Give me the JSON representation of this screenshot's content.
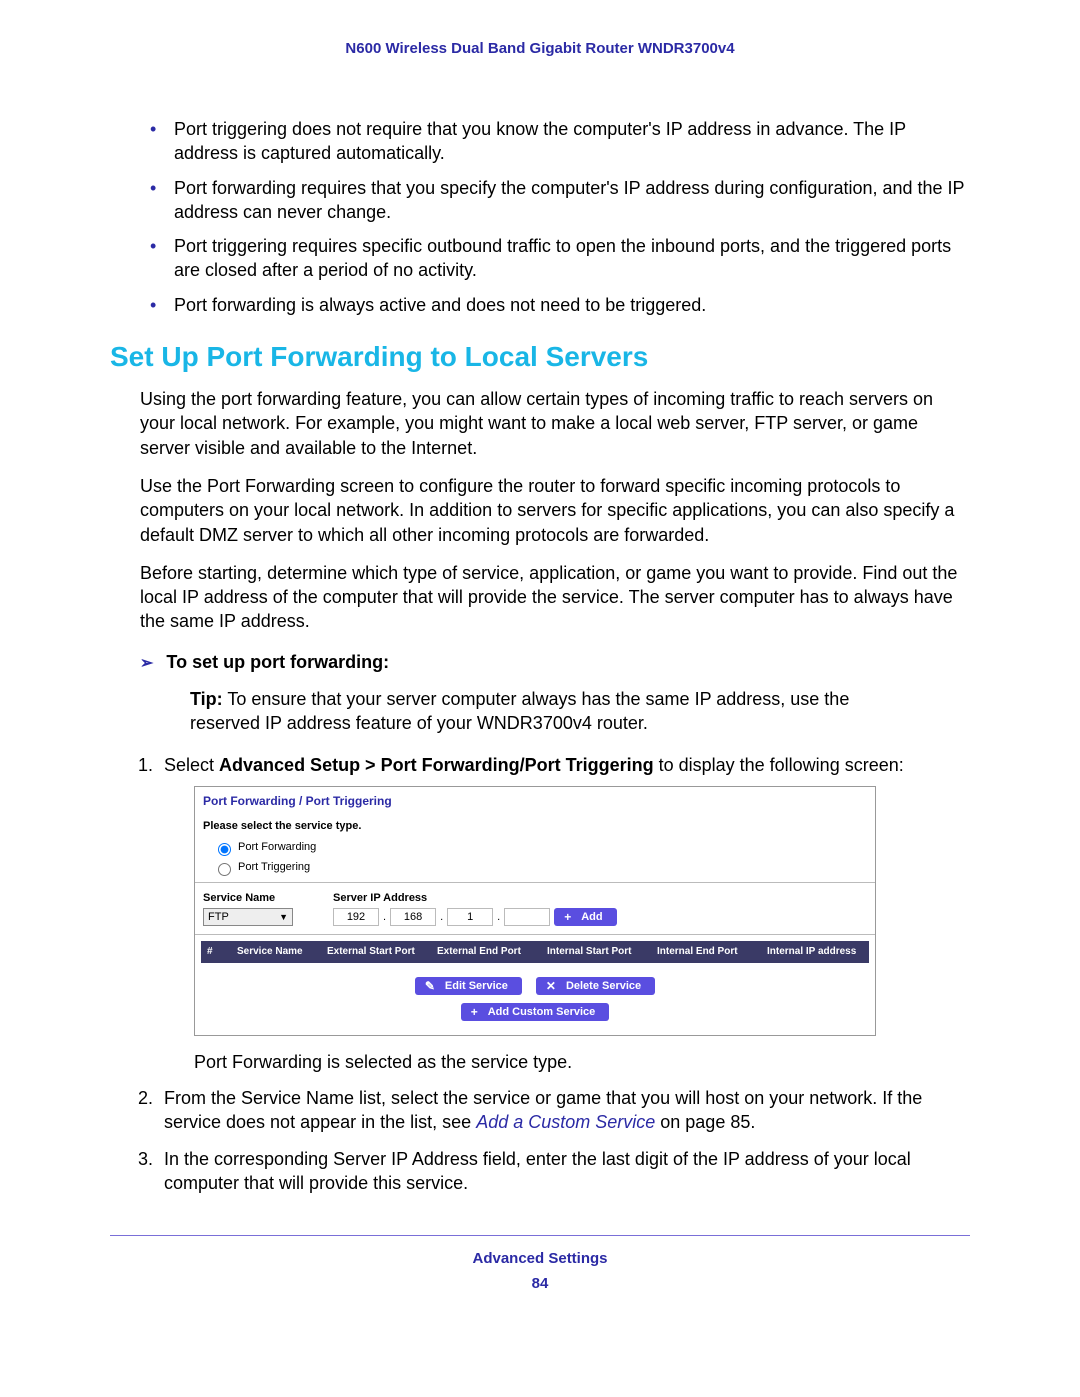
{
  "header": {
    "title": "N600 Wireless Dual Band Gigabit Router WNDR3700v4"
  },
  "bullets": [
    "Port triggering does not require that you know the computer's IP address in advance. The IP address is captured automatically.",
    "Port forwarding requires that you specify the computer's IP address during configuration, and the IP address can never change.",
    "Port triggering requires specific outbound traffic to open the inbound ports, and the triggered ports are closed after a period of no activity.",
    "Port forwarding is always active and does not need to be triggered."
  ],
  "section": {
    "heading": "Set Up Port Forwarding to Local Servers"
  },
  "paras": {
    "p1": "Using the port forwarding feature, you can allow certain types of incoming traffic to reach servers on your local network. For example, you might want to make a local web server, FTP server, or game server visible and available to the Internet.",
    "p2": "Use the Port Forwarding screen to configure the router to forward specific incoming protocols to computers on your local network. In addition to servers for specific applications, you can also specify a default DMZ server to which all other incoming protocols are forwarded.",
    "p3": "Before starting, determine which type of service, application, or game you want to provide. Find out the local IP address of the computer that will provide the service. The server computer has to always have the same IP address."
  },
  "proc": {
    "heading": "To set up port forwarding:",
    "tip_label": "Tip:",
    "tip": " To ensure that your server computer always has the same IP address, use the reserved IP address feature of your WNDR3700v4 router.",
    "step1_prefix": "Select ",
    "step1_bold": "Advanced Setup > Port Forwarding/Port Triggering",
    "step1_suffix": " to display the following screen:",
    "after_shot": "Port Forwarding is selected as the service type.",
    "step2_a": "From the Service Name list, select the service or game that you will host on your network. If the service does not appear in the list, see ",
    "step2_link": "Add a Custom Service",
    "step2_b": " on page 85.",
    "step3": "In the corresponding Server IP Address field, enter the last digit of the IP address of your local computer that will provide this service."
  },
  "ui": {
    "title": "Port Forwarding / Port Triggering",
    "select_label": "Please select the service type.",
    "radio1": "Port Forwarding",
    "radio2": "Port Triggering",
    "service_name_label": "Service Name",
    "server_ip_label": "Server IP Address",
    "service_value": "FTP",
    "ip": {
      "o1": "192",
      "o2": "168",
      "o3": "1",
      "o4": ""
    },
    "add_btn": "Add",
    "columns": {
      "c0": "#",
      "c1": "Service Name",
      "c2": "External Start Port",
      "c3": "External End Port",
      "c4": "Internal Start Port",
      "c5": "Internal End Port",
      "c6": "Internal IP address"
    },
    "edit_btn": "Edit Service",
    "delete_btn": "Delete Service",
    "add_custom_btn": "Add Custom Service"
  },
  "footer": {
    "section": "Advanced Settings",
    "page": "84"
  }
}
